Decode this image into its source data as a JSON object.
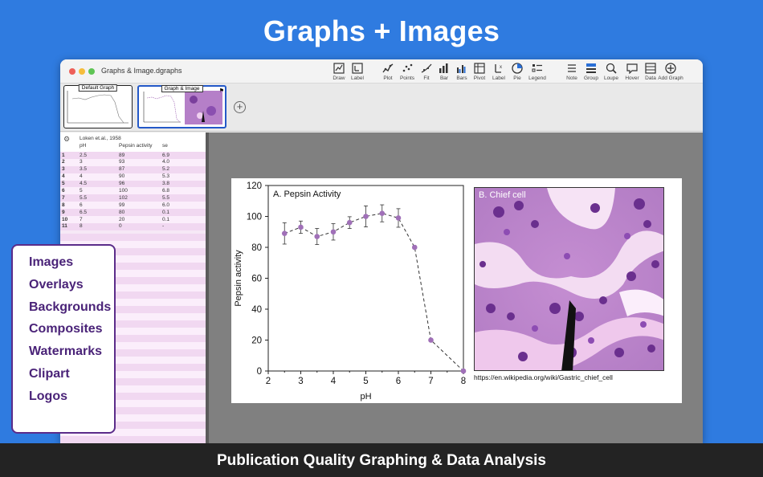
{
  "hero": {
    "title": "Graphs + Images"
  },
  "window": {
    "title": "Graphs & Image.dgraphs"
  },
  "toolbar": [
    {
      "label": "Draw",
      "icon": "draw-icon"
    },
    {
      "label": "Label",
      "icon": "label-icon"
    },
    {
      "label": "Plot",
      "icon": "plot-icon"
    },
    {
      "label": "Points",
      "icon": "points-icon"
    },
    {
      "label": "Fit",
      "icon": "fit-icon"
    },
    {
      "label": "Bar",
      "icon": "bar-icon"
    },
    {
      "label": "Bars",
      "icon": "bars-icon"
    },
    {
      "label": "Pivot",
      "icon": "pivot-icon"
    },
    {
      "label": "Label",
      "icon": "axis-label-icon"
    },
    {
      "label": "Pie",
      "icon": "pie-icon"
    },
    {
      "label": "Legend",
      "icon": "legend-icon"
    },
    {
      "label": "Note",
      "icon": "note-icon"
    },
    {
      "label": "Group",
      "icon": "group-icon"
    },
    {
      "label": "Loupe",
      "icon": "loupe-icon"
    },
    {
      "label": "Hover",
      "icon": "hover-icon"
    },
    {
      "label": "Data",
      "icon": "data-icon"
    },
    {
      "label": "Add Graph",
      "icon": "add-graph-icon"
    }
  ],
  "thumbnails": [
    {
      "caption": "Default Graph",
      "active": false
    },
    {
      "caption": "Graph & Image",
      "active": true
    }
  ],
  "table": {
    "source": "Loken et.al., 1958",
    "columns": [
      "pH",
      "Pepsin activity",
      "se"
    ],
    "rows": [
      [
        "1",
        "2.5",
        "89",
        "6.9"
      ],
      [
        "2",
        "3",
        "93",
        "4.0"
      ],
      [
        "3",
        "3.5",
        "87",
        "5.2"
      ],
      [
        "4",
        "4",
        "90",
        "5.3"
      ],
      [
        "5",
        "4.5",
        "96",
        "3.8"
      ],
      [
        "6",
        "5",
        "100",
        "6.8"
      ],
      [
        "7",
        "5.5",
        "102",
        "5.5"
      ],
      [
        "8",
        "6",
        "99",
        "6.0"
      ],
      [
        "9",
        "6.5",
        "80",
        "0.1"
      ],
      [
        "10",
        "7",
        "20",
        "0.1"
      ],
      [
        "11",
        "8",
        "0",
        "-"
      ]
    ]
  },
  "image_panel": {
    "title": "B. Chief cell",
    "caption": "https://en.wikipedia.org/wiki/Gastric_chief_cell"
  },
  "sidebar": {
    "items": [
      "Images",
      "Overlays",
      "Backgrounds",
      "Composites",
      "Watermarks",
      "Clipart",
      "Logos"
    ]
  },
  "footer": {
    "text": "Publication Quality Graphing & Data Analysis"
  },
  "chart_data": {
    "type": "line",
    "title": "A. Pepsin Activity",
    "xlabel": "pH",
    "ylabel": "Pepsin activity",
    "x": [
      2.5,
      3,
      3.5,
      4,
      4.5,
      5,
      5.5,
      6,
      6.5,
      7,
      8
    ],
    "series": [
      {
        "values": [
          89,
          93,
          87,
          90,
          96,
          100,
          102,
          99,
          80,
          20,
          0
        ],
        "error": [
          6.9,
          4.0,
          5.2,
          5.3,
          3.8,
          6.8,
          5.5,
          6.0,
          0.1,
          0.1,
          0
        ],
        "color": "#a070b8",
        "line": "dashed"
      }
    ],
    "xlim": [
      2,
      8
    ],
    "ylim": [
      0,
      120
    ],
    "xticks": [
      "2",
      "3",
      "4",
      "5",
      "6",
      "7",
      "8"
    ],
    "yticks": [
      "0",
      "20",
      "40",
      "60",
      "80",
      "100",
      "120"
    ]
  }
}
